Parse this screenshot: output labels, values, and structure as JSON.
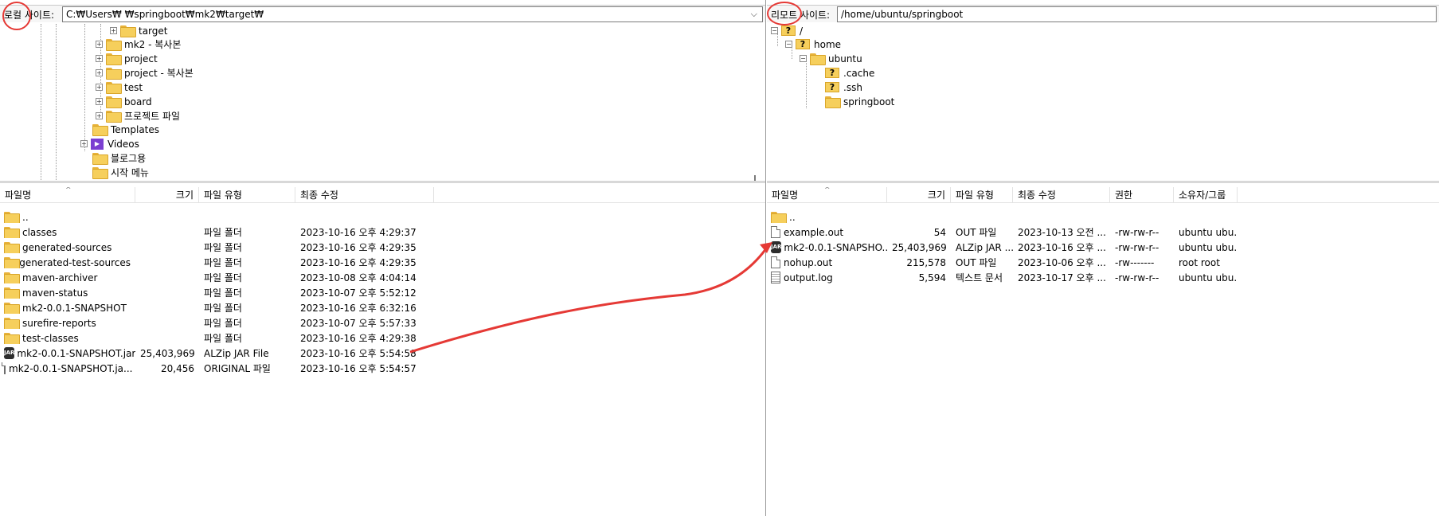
{
  "local": {
    "site_label": "로컬 사이트:",
    "path": "C:₩Users₩        ₩springboot₩mk2₩target₩",
    "tree": [
      {
        "label": "target",
        "icon": "folder-icon",
        "expander": "+"
      },
      {
        "label": "mk2 - 복사본",
        "icon": "folder-icon",
        "expander": "+"
      },
      {
        "label": "project",
        "icon": "folder-icon",
        "expander": "+"
      },
      {
        "label": "project - 복사본",
        "icon": "folder-icon",
        "expander": "+"
      },
      {
        "label": "test",
        "icon": "folder-icon",
        "expander": "+"
      },
      {
        "label": "board",
        "icon": "folder-icon",
        "expander": "+"
      },
      {
        "label": "프로젝트 파일",
        "icon": "folder-icon",
        "expander": "+"
      },
      {
        "label": "Templates",
        "icon": "folder-icon",
        "expander": ""
      },
      {
        "label": "Videos",
        "icon": "video-icon",
        "expander": "+"
      },
      {
        "label": "블로그용",
        "icon": "folder-icon",
        "expander": ""
      },
      {
        "label": "시작 메뉴",
        "icon": "folder-icon",
        "expander": ""
      }
    ],
    "columns": {
      "name": "파일명",
      "size": "크기",
      "type": "파일 유형",
      "modified": "최종 수정"
    },
    "files": [
      {
        "name": "..",
        "size": "",
        "type": "",
        "modified": "",
        "icon": "folder-icon"
      },
      {
        "name": "classes",
        "size": "",
        "type": "파일 폴더",
        "modified": "2023-10-16 오후 4:29:37",
        "icon": "folder-icon"
      },
      {
        "name": "generated-sources",
        "size": "",
        "type": "파일 폴더",
        "modified": "2023-10-16 오후 4:29:35",
        "icon": "folder-icon"
      },
      {
        "name": "generated-test-sources",
        "size": "",
        "type": "파일 폴더",
        "modified": "2023-10-16 오후 4:29:35",
        "icon": "folder-icon"
      },
      {
        "name": "maven-archiver",
        "size": "",
        "type": "파일 폴더",
        "modified": "2023-10-08 오후 4:04:14",
        "icon": "folder-icon"
      },
      {
        "name": "maven-status",
        "size": "",
        "type": "파일 폴더",
        "modified": "2023-10-07 오후 5:52:12",
        "icon": "folder-icon"
      },
      {
        "name": "mk2-0.0.1-SNAPSHOT",
        "size": "",
        "type": "파일 폴더",
        "modified": "2023-10-16 오후 6:32:16",
        "icon": "folder-icon"
      },
      {
        "name": "surefire-reports",
        "size": "",
        "type": "파일 폴더",
        "modified": "2023-10-07 오후 5:57:33",
        "icon": "folder-icon"
      },
      {
        "name": "test-classes",
        "size": "",
        "type": "파일 폴더",
        "modified": "2023-10-16 오후 4:29:38",
        "icon": "folder-icon"
      },
      {
        "name": "mk2-0.0.1-SNAPSHOT.jar",
        "size": "25,403,969",
        "type": "ALZip JAR File",
        "modified": "2023-10-16 오후 5:54:58",
        "icon": "jar-icon"
      },
      {
        "name": "mk2-0.0.1-SNAPSHOT.ja...",
        "size": "20,456",
        "type": "ORIGINAL 파일",
        "modified": "2023-10-16 오후 5:54:57",
        "icon": "file-icon"
      }
    ]
  },
  "remote": {
    "site_label": "리모트 사이트:",
    "path": "/home/ubuntu/springboot",
    "tree": [
      {
        "label": "/",
        "icon": "question-folder-icon",
        "expander": "-"
      },
      {
        "label": "home",
        "icon": "question-folder-icon",
        "expander": "-"
      },
      {
        "label": "ubuntu",
        "icon": "folder-icon",
        "expander": "-"
      },
      {
        "label": ".cache",
        "icon": "question-folder-icon",
        "expander": ""
      },
      {
        "label": ".ssh",
        "icon": "question-folder-icon",
        "expander": ""
      },
      {
        "label": "springboot",
        "icon": "folder-icon",
        "expander": ""
      }
    ],
    "columns": {
      "name": "파일명",
      "size": "크기",
      "type": "파일 유형",
      "modified": "최종 수정",
      "perm": "권한",
      "owner": "소유자/그룹"
    },
    "files": [
      {
        "name": "..",
        "size": "",
        "type": "",
        "modified": "",
        "perm": "",
        "owner": "",
        "icon": "folder-icon"
      },
      {
        "name": "example.out",
        "size": "54",
        "type": "OUT 파일",
        "modified": "2023-10-13 오전 ...",
        "perm": "-rw-rw-r--",
        "owner": "ubuntu ubu...",
        "icon": "file-icon"
      },
      {
        "name": "mk2-0.0.1-SNAPSHO...",
        "size": "25,403,969",
        "type": "ALZip JAR ...",
        "modified": "2023-10-16 오후 ...",
        "perm": "-rw-rw-r--",
        "owner": "ubuntu ubu...",
        "icon": "jar-icon"
      },
      {
        "name": "nohup.out",
        "size": "215,578",
        "type": "OUT 파일",
        "modified": "2023-10-06 오후 ...",
        "perm": "-rw-------",
        "owner": "root root",
        "icon": "file-icon"
      },
      {
        "name": "output.log",
        "size": "5,594",
        "type": "텍스트 문서",
        "modified": "2023-10-17 오후 ...",
        "perm": "-rw-rw-r--",
        "owner": "ubuntu ubu...",
        "icon": "text-file-icon"
      }
    ]
  },
  "colors": {
    "annotation": "#e53935",
    "folder": "#f6cf5c"
  }
}
